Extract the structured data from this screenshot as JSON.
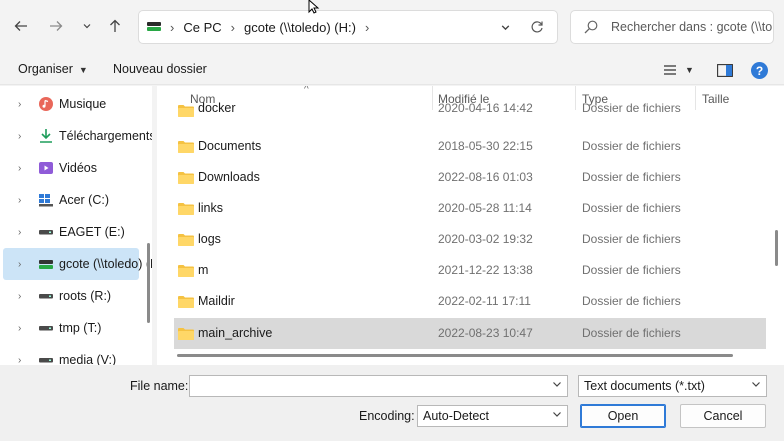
{
  "address_bar": {
    "crumbs": [
      "Ce PC",
      "gcote (\\\\toledo) (H:)"
    ],
    "search_placeholder": "Rechercher dans : gcote (\\\\toledo) (H:)"
  },
  "toolbar": {
    "organize_label": "Organiser",
    "new_folder_label": "Nouveau dossier"
  },
  "nav_pane": {
    "items": [
      {
        "label": "Musique",
        "icon": "music-icon"
      },
      {
        "label": "Téléchargements",
        "icon": "download-icon"
      },
      {
        "label": "Vidéos",
        "icon": "video-icon"
      },
      {
        "label": "Acer (C:)",
        "icon": "windows-drive-icon"
      },
      {
        "label": "EAGET (E:)",
        "icon": "drive-icon"
      },
      {
        "label": "gcote (\\\\toledo) (H:)",
        "icon": "network-drive-icon",
        "selected": true
      },
      {
        "label": "roots (R:)",
        "icon": "drive-icon"
      },
      {
        "label": "tmp (T:)",
        "icon": "drive-icon"
      },
      {
        "label": "media (V:)",
        "icon": "drive-icon"
      }
    ]
  },
  "file_list": {
    "columns": {
      "name": "Nom",
      "modified": "Modifié le",
      "type": "Type",
      "size": "Taille"
    },
    "rows": [
      {
        "name": "docker",
        "modified": "2020-04-16 14:42",
        "type": "Dossier de fichiers"
      },
      {
        "name": "Documents",
        "modified": "2018-05-30 22:15",
        "type": "Dossier de fichiers"
      },
      {
        "name": "Downloads",
        "modified": "2022-08-16 01:03",
        "type": "Dossier de fichiers"
      },
      {
        "name": "links",
        "modified": "2020-05-28 11:14",
        "type": "Dossier de fichiers"
      },
      {
        "name": "logs",
        "modified": "2020-03-02 19:32",
        "type": "Dossier de fichiers"
      },
      {
        "name": "m",
        "modified": "2021-12-22 13:38",
        "type": "Dossier de fichiers"
      },
      {
        "name": "Maildir",
        "modified": "2022-02-11 17:11",
        "type": "Dossier de fichiers"
      },
      {
        "name": "main_archive",
        "modified": "2022-08-23 10:47",
        "type": "Dossier de fichiers",
        "selected": true
      }
    ]
  },
  "bottom": {
    "file_name_label": "File name:",
    "file_name_value": "",
    "file_type_value": "Text documents (*.txt)",
    "encoding_label": "Encoding:",
    "encoding_value": "Auto-Detect",
    "open_label": "Open",
    "cancel_label": "Cancel"
  },
  "colors": {
    "selected_nav": "#cce4f7",
    "selected_row": "#d9d9d9",
    "folder": "#f5c242",
    "accent": "#2f7ad7"
  }
}
